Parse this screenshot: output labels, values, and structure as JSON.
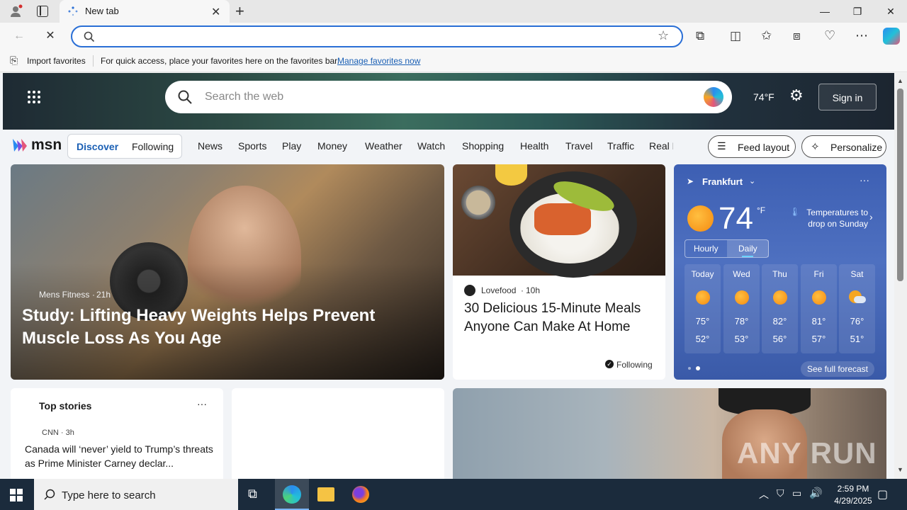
{
  "browser": {
    "tab_title": "New tab",
    "omnibox_value": "",
    "favbar": {
      "import_label": "Import favorites",
      "hint": "For quick access, place your favorites here on the favorites bar.",
      "manage_link": "Manage favorites now"
    }
  },
  "hero": {
    "search_placeholder": "Search the web",
    "temperature": "74°F",
    "signin_label": "Sign in"
  },
  "msn": {
    "logo_text": "msn",
    "feed_tabs": [
      "Discover",
      "Following"
    ],
    "nav_items": [
      "News",
      "Sports",
      "Play",
      "Money",
      "Weather",
      "Watch",
      "Shopping",
      "Health",
      "Travel",
      "Traffic",
      "Real E"
    ],
    "feed_layout_label": "Feed layout",
    "personalize_label": "Personalize"
  },
  "main_story": {
    "source": "Mens Fitness",
    "age": "21h",
    "headline": "Study: Lifting Heavy Weights Helps Prevent Muscle Loss As You Age"
  },
  "food_story": {
    "source": "Lovefood",
    "age": "10h",
    "headline": "30 Delicious 15-Minute Meals Anyone Can Make At Home",
    "following_label": "Following"
  },
  "weather": {
    "location": "Frankfurt",
    "temp": "74",
    "unit": "°F",
    "alert": "Temperatures to drop on Sunday",
    "tabs": [
      "Hourly",
      "Daily"
    ],
    "days": [
      {
        "name": "Today",
        "high": "75°",
        "low": "52°",
        "icon": "sun-icon"
      },
      {
        "name": "Wed",
        "high": "78°",
        "low": "53°",
        "icon": "sun-icon"
      },
      {
        "name": "Thu",
        "high": "82°",
        "low": "56°",
        "icon": "sun-icon"
      },
      {
        "name": "Fri",
        "high": "81°",
        "low": "57°",
        "icon": "sun-icon"
      },
      {
        "name": "Sat",
        "high": "76°",
        "low": "51°",
        "icon": "partly-cloudy-icon"
      }
    ],
    "full_forecast_label": "See full forecast"
  },
  "top_stories": {
    "title": "Top stories",
    "items": [
      {
        "source": "CNN · 3h",
        "headline": "Canada will ‘never’ yield to Trump’s threats as Prime Minister Carney declar..."
      }
    ]
  },
  "taskbar": {
    "search_placeholder": "Type here to search",
    "time": "2:59 PM",
    "date": "4/29/2025"
  },
  "watermark": "ANY RUN"
}
